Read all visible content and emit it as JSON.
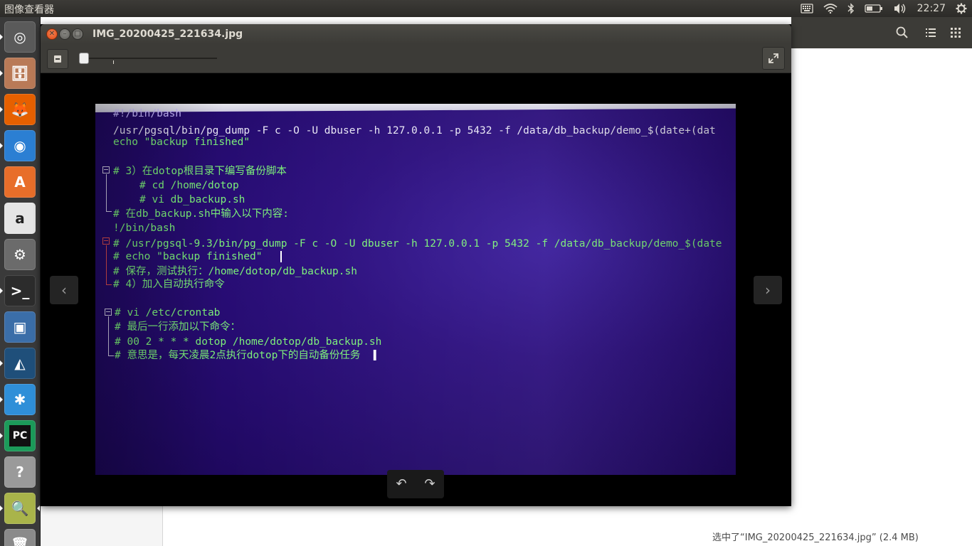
{
  "top_panel": {
    "app_name": "图像查看器",
    "clock": "22:27",
    "tray_icons": [
      "keyboard-icon",
      "wifi-icon",
      "bluetooth-icon",
      "battery-icon",
      "volume-icon",
      "settings-gear-icon"
    ]
  },
  "launcher": {
    "items": [
      {
        "name": "dash-home",
        "glyph": "◎",
        "color": "#5a5a5a"
      },
      {
        "name": "files",
        "glyph": "🗄",
        "color": "#b97a57"
      },
      {
        "name": "firefox",
        "glyph": "🦊",
        "color": "#e66000"
      },
      {
        "name": "chrome",
        "glyph": "◉",
        "color": "#2b7fd3"
      },
      {
        "name": "software-center",
        "glyph": "A",
        "color": "#e86e2a"
      },
      {
        "name": "amazon",
        "glyph": "a",
        "color": "#e5e5e5"
      },
      {
        "name": "system-settings",
        "glyph": "⚙",
        "color": "#6b6b6b"
      },
      {
        "name": "terminal",
        "glyph": ">_",
        "color": "#2c2c2c"
      },
      {
        "name": "virtualbox",
        "glyph": "▣",
        "color": "#3b6ea8"
      },
      {
        "name": "mysql-workbench",
        "glyph": "◭",
        "color": "#1f4f7a"
      },
      {
        "name": "kde-app",
        "glyph": "✱",
        "color": "#2f8fd8"
      },
      {
        "name": "pycharm",
        "glyph": "PC",
        "color": "#1c9b5a"
      },
      {
        "name": "help",
        "glyph": "?",
        "color": "#9a9a9a"
      },
      {
        "name": "image-viewer",
        "glyph": "🔍",
        "color": "#a9b44a"
      },
      {
        "name": "trash",
        "glyph": "🗑",
        "color": "#8a8a8a"
      }
    ]
  },
  "viewer": {
    "title": "IMG_20200425_221634.jpg",
    "zoom_level": 0.03
  },
  "photo": {
    "lines": [
      {
        "text": "#!/bin/bash",
        "cls": "c-lilac"
      },
      {
        "text": "/usr/pgsql/bin/pg_dump -F c -O -U dbuser -h 127.0.0.1 -p 5432 -f /data/db_backup/demo_$(date+(dat",
        "cls": "c-white"
      },
      {
        "text": "echo \"backup finished\"",
        "cls": "c-green"
      },
      {
        "text": "# 3）在dotop根目录下编写备份脚本",
        "cls": "c-green"
      },
      {
        "text": "# cd /home/dotop",
        "cls": "c-green"
      },
      {
        "text": "# vi db_backup.sh",
        "cls": "c-green"
      },
      {
        "text": "# 在db_backup.sh中输入以下内容:",
        "cls": "c-green"
      },
      {
        "text": "!/bin/bash",
        "cls": "c-green"
      },
      {
        "text": "# /usr/pgsql-9.3/bin/pg_dump -F c -O -U dbuser -h 127.0.0.1 -p 5432 -f /data/db_backup/demo_$(date",
        "cls": "c-green"
      },
      {
        "text": "# echo \"backup finished\"",
        "cls": "c-green"
      },
      {
        "text": "# 保存，测试执行：/home/dotop/db_backup.sh",
        "cls": "c-green"
      },
      {
        "text": "# 4）加入自动执行命令",
        "cls": "c-green"
      },
      {
        "text": "# vi  /etc/crontab",
        "cls": "c-green"
      },
      {
        "text": "# 最后一行添加以下命令：",
        "cls": "c-green"
      },
      {
        "text": "# 00 2 * * * dotop /home/dotop/db_backup.sh",
        "cls": "c-green"
      },
      {
        "text": "# 意思是，每天凌晨2点执行dotop下的自动备份任务",
        "cls": "c-green"
      }
    ]
  },
  "file_manager": {
    "status_text": "选中了“IMG_20200425_221634.jpg” (2.4 MB)"
  }
}
